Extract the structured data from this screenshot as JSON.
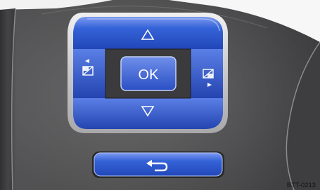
{
  "image": {
    "subject": "steering-wheel-multifunction-control-pad",
    "reference_code": "BTT-0213"
  },
  "controls": {
    "ok_label": "OK",
    "up_icon": "triangle-up-outline-icon",
    "down_icon": "triangle-down-outline-icon",
    "left_icon": "display-page-previous-icon",
    "right_icon": "display-page-next-icon",
    "back_icon": "return-arrow-icon"
  },
  "colors": {
    "button_blue": "#2b56cf",
    "button_blue_light": "#6f90ec",
    "bezel_silver": "#d8d8d8",
    "housing_dark": "#4a4a4c",
    "housing_mid": "#6a6a6c"
  }
}
